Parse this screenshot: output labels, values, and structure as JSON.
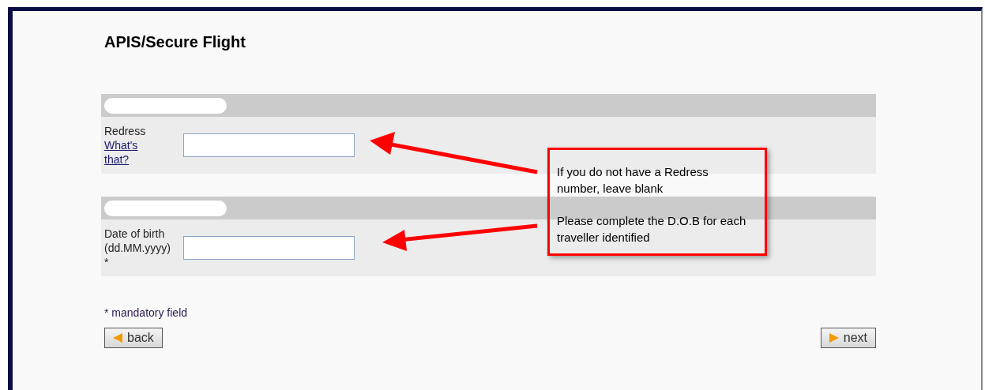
{
  "title": "APIS/Secure Flight",
  "sections": [
    {
      "redacted": true,
      "fields": [
        {
          "label": "Redress",
          "link": "What's that?"
        }
      ]
    },
    {
      "redacted": true,
      "fields": [
        {
          "label": "Date of birth (dd.MM.yyyy)",
          "marker": "*"
        }
      ]
    }
  ],
  "note": "* mandatory field",
  "buttons": [
    {
      "kind": "back",
      "label": "back"
    },
    {
      "kind": "next",
      "label": "next"
    }
  ],
  "callout": {
    "paragraphs": [
      "If you do not have a Redress number, leave blank",
      "Please complete the D.O.B for each traveller identified"
    ]
  }
}
